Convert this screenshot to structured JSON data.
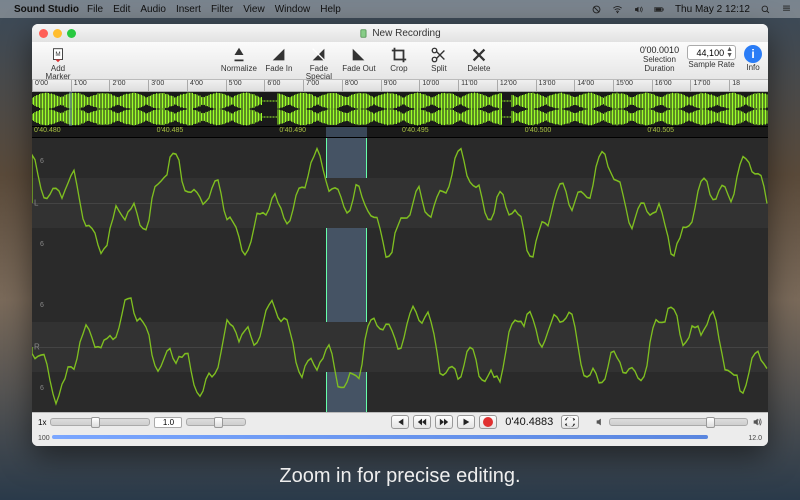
{
  "menubar": {
    "app": "Sound Studio",
    "items": [
      "File",
      "Edit",
      "Audio",
      "Insert",
      "Filter",
      "View",
      "Window",
      "Help"
    ],
    "clock": "Thu May 2  12:12"
  },
  "window": {
    "title": "New Recording",
    "traffic": [
      "close",
      "minimize",
      "zoom"
    ]
  },
  "toolbar": {
    "left": [
      {
        "id": "add-marker",
        "label": "Add Marker"
      }
    ],
    "center": [
      {
        "id": "normalize",
        "label": "Normalize"
      },
      {
        "id": "fade-in",
        "label": "Fade In"
      },
      {
        "id": "fade-special",
        "label": "Fade Special"
      },
      {
        "id": "fade-out",
        "label": "Fade Out"
      },
      {
        "id": "crop",
        "label": "Crop"
      },
      {
        "id": "split",
        "label": "Split"
      },
      {
        "id": "delete",
        "label": "Delete"
      }
    ],
    "selection": {
      "value": "0'00.0010",
      "label": "Selection"
    },
    "duration_label": "Duration",
    "sample_rate": {
      "value": "44,100",
      "label": "Sample Rate"
    },
    "info_label": "Info"
  },
  "ruler_top": [
    "0'00",
    "1'00",
    "2'00",
    "3'00",
    "4'00",
    "5'00",
    "6'00",
    "7'00",
    "8'00",
    "9'00",
    "10'00",
    "11'00",
    "12'00",
    "13'00",
    "14'00",
    "15'00",
    "16'00",
    "17'00",
    "18"
  ],
  "ruler_fine": [
    "0'40.480",
    "0'40.485",
    "0'40.490",
    "0'40.495",
    "0'40.500",
    "0'40.505"
  ],
  "channels": {
    "left_label": "L",
    "right_label": "R",
    "scale": "6"
  },
  "transport": {
    "zoom_label": "1x",
    "zoom_value": "1.0",
    "timecode": "0'40.4883",
    "scrub_left": "100",
    "scrub_right": "12.0"
  },
  "selection_range": {
    "overview_left_pct": 5.0,
    "overview_width_pct": 0.4,
    "wave_left_pct": 40.0,
    "wave_width_pct": 5.5
  },
  "caption": "Zoom in for precise editing.",
  "colors": {
    "wave": "#9cff2a",
    "wave_dim": "#7fbf20",
    "sel": "rgba(120,160,210,.4)"
  }
}
